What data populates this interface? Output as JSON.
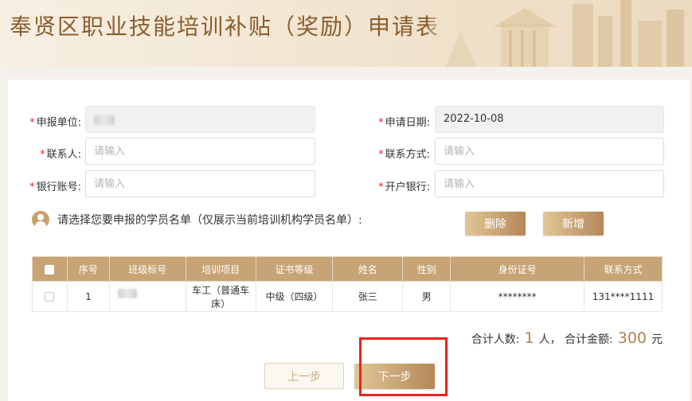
{
  "header": {
    "title": "奉贤区职业技能培训补贴（奖励）申请表"
  },
  "form": {
    "required_mark": "*",
    "unit": {
      "label": "申报单位:"
    },
    "apply_date": {
      "label": "申请日期:",
      "value": "2022-10-08"
    },
    "contact": {
      "label": "联系人:",
      "placeholder": "请输入"
    },
    "contact_method": {
      "label": "联系方式:",
      "placeholder": "请输入"
    },
    "bank_account": {
      "label": "银行账号:",
      "placeholder": "请输入"
    },
    "bank_name": {
      "label": "开户银行:",
      "placeholder": "请输入"
    }
  },
  "roster": {
    "prompt": "请选择您要申报的学员名单（仅展示当前培训机构学员名单）:",
    "delete_label": "删除",
    "add_label": "新增"
  },
  "table": {
    "headers": [
      "序号",
      "班级标号",
      "培训项目",
      "证书等级",
      "姓名",
      "性别",
      "身份证号",
      "联系方式"
    ],
    "rows": [
      {
        "index": "1",
        "project": "车工（普通车床）",
        "level": "中级（四级）",
        "name": "张三",
        "gender": "男",
        "id_number": "********",
        "phone": "131****1111"
      }
    ]
  },
  "totals": {
    "people_label": "合计人数:",
    "people_count": "1",
    "people_unit": "人，",
    "amount_label": "合计金额:",
    "amount_value": "300",
    "amount_unit": "元"
  },
  "nav": {
    "prev_label": "上一步",
    "next_label": "下一步"
  },
  "colors": {
    "accent": "#c7a475",
    "title": "#8a5d2e",
    "highlight": "#e8231e"
  }
}
